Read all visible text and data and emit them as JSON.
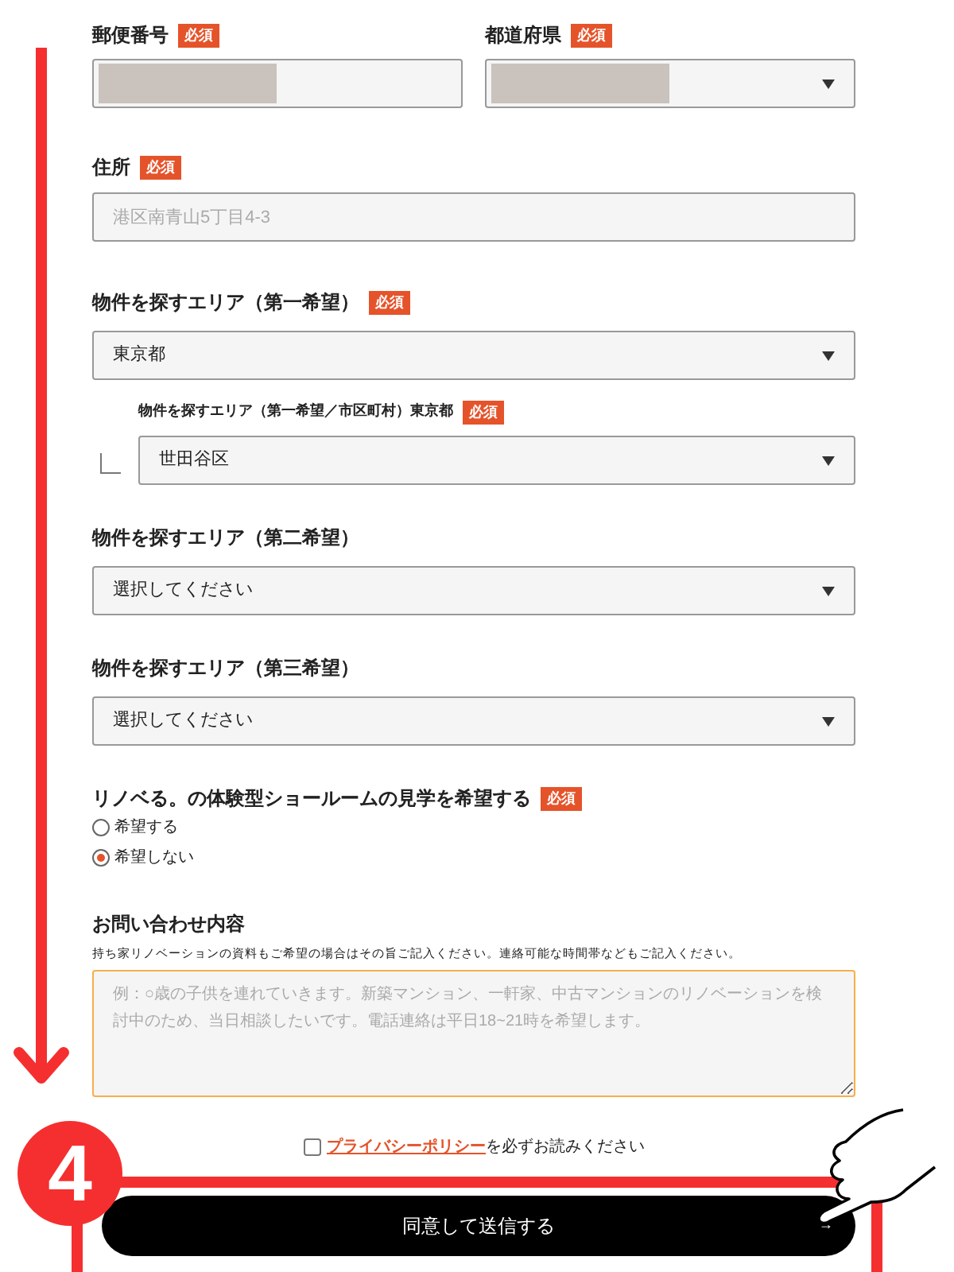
{
  "address_row": [
    {
      "label": "郵便番号",
      "badge": "必須",
      "kind": "text",
      "redacted": true
    },
    {
      "label": "都道府県",
      "badge": "必須",
      "kind": "select",
      "redacted": true
    }
  ],
  "street": {
    "label": "住所",
    "badge": "必須",
    "placeholder": "港区南青山5丁目4-3"
  },
  "areas": [
    {
      "label": "物件を探すエリア（第一希望）",
      "badge": "必須",
      "value": "東京都",
      "sub": {
        "label": "物件を探すエリア（第一希望／市区町村）東京都",
        "badge": "必須",
        "value": "世田谷区"
      }
    },
    {
      "label": "物件を探すエリア（第二希望）",
      "value": "選択してください"
    },
    {
      "label": "物件を探すエリア（第三希望）",
      "value": "選択してください"
    }
  ],
  "showroom": {
    "label": "リノベる。の体験型ショールームの見学を希望する",
    "badge": "必須",
    "options": [
      {
        "label": "希望する",
        "selected": false
      },
      {
        "label": "希望しない",
        "selected": true
      }
    ]
  },
  "inquiry": {
    "label": "お問い合わせ内容",
    "description": "持ち家リノベーションの資料もご希望の場合はその旨ご記入ください。連絡可能な時間帯などもご記入ください。",
    "placeholder": "例：○歳の子供を連れていきます。新築マンション、一軒家、中古マンションのリノベーションを検討中のため、当日相談したいです。電話連絡は平日18~21時を希望します。",
    "focused": true
  },
  "privacy": {
    "checked": false,
    "link": "プライバシーポリシー",
    "text": "を必ずお読みください"
  },
  "submit": {
    "label": "同意して送信する",
    "arrow": "→"
  },
  "step_badge": "4"
}
